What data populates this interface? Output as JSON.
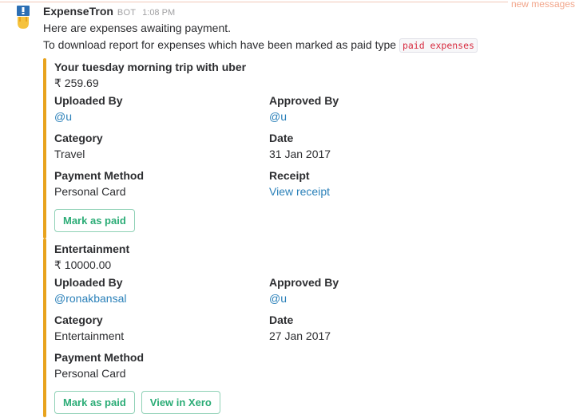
{
  "divider_label": "new messages",
  "colors": {
    "accent_bar": "#e8a31d",
    "button": "#2bac76",
    "link": "#2a80b9",
    "new_divider": "#f2a68b"
  },
  "message": {
    "sender": "ExpenseTron",
    "badge": "BOT",
    "time": "1:08 PM",
    "line1": "Here are expenses awaiting payment.",
    "line2": "To download report for expenses which have been marked as paid type",
    "command": "paid expenses"
  },
  "expenses": [
    {
      "title": "Your tuesday morning trip with uber",
      "amount": "₹ 259.69",
      "uploaded_by_label": "Uploaded By",
      "uploaded_by": "@u",
      "approved_by_label": "Approved By",
      "approved_by": "@u",
      "category_label": "Category",
      "category": "Travel",
      "date_label": "Date",
      "date": "31 Jan 2017",
      "payment_method_label": "Payment Method",
      "payment_method": "Personal Card",
      "receipt_label": "Receipt",
      "receipt": "View receipt",
      "mark_paid": "Mark as paid"
    },
    {
      "title": "Entertainment",
      "amount": "₹ 10000.00",
      "uploaded_by_label": "Uploaded By",
      "uploaded_by": "@ronakbansal",
      "approved_by_label": "Approved By",
      "approved_by": "@u",
      "category_label": "Category",
      "category": "Entertainment",
      "date_label": "Date",
      "date": "27 Jan 2017",
      "payment_method_label": "Payment Method",
      "payment_method": "Personal Card",
      "mark_paid": "Mark as paid",
      "view_xero": "View in Xero"
    }
  ]
}
